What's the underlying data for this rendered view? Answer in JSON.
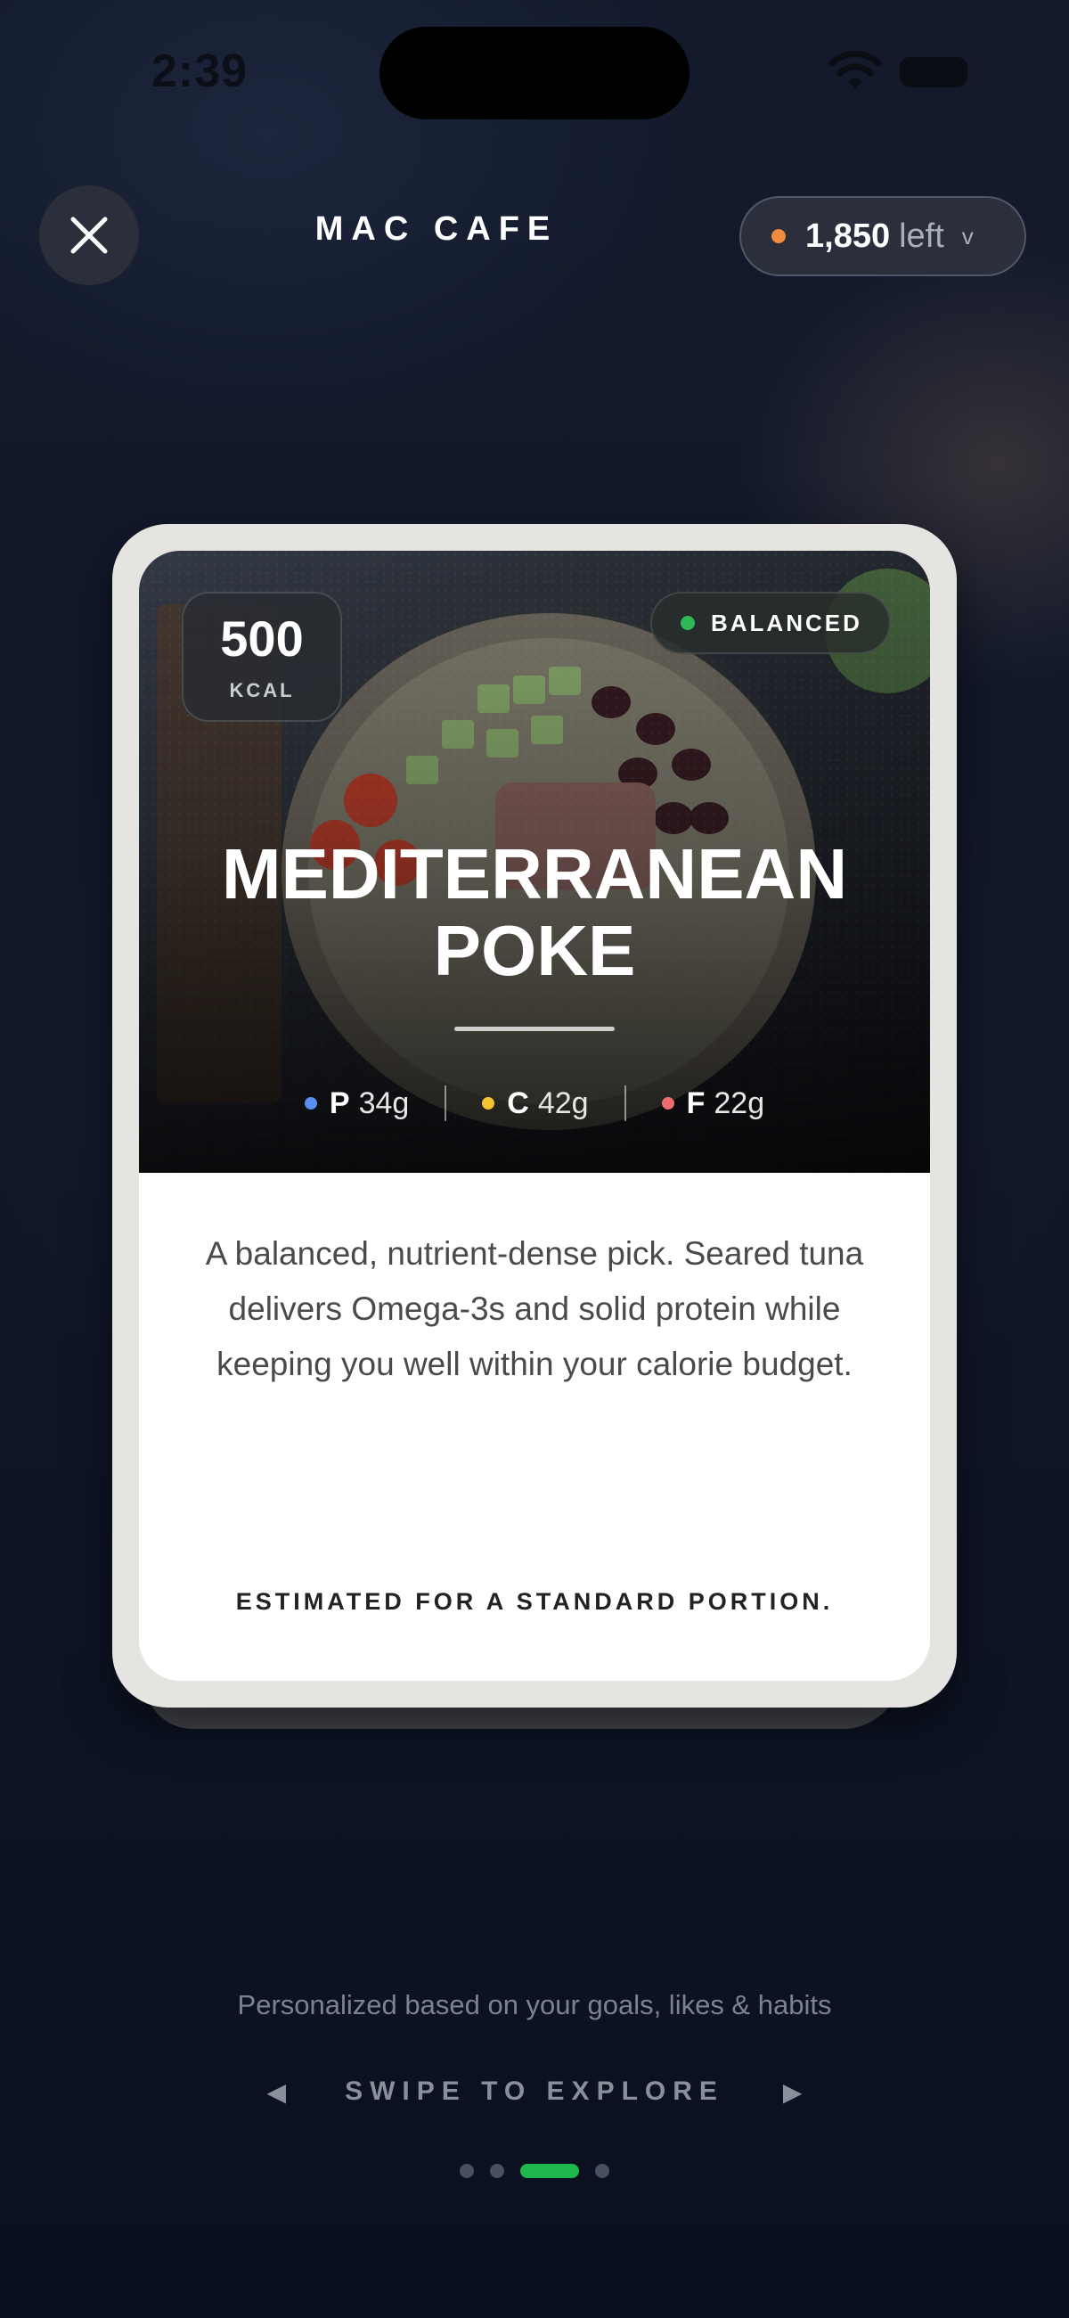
{
  "status_bar": {
    "time": "2:39"
  },
  "header": {
    "title": "MAC CAFE",
    "calories_left_value": "1,850",
    "calories_left_label": "left",
    "dropdown_glyph": "v"
  },
  "card": {
    "kcal_value": "500",
    "kcal_unit": "KCAL",
    "badge": "BALANCED",
    "dish_line1": "MEDITERRANEAN",
    "dish_line2": "POKE",
    "macros": [
      {
        "letter": "P",
        "value": "34g",
        "color": "#5b8def"
      },
      {
        "letter": "C",
        "value": "42g",
        "color": "#f2c531"
      },
      {
        "letter": "F",
        "value": "22g",
        "color": "#ee6b6b"
      }
    ],
    "description": "A balanced, nutrient-dense pick. Seared tuna delivers Omega-3s and solid protein while keeping you well within your calorie budget.",
    "footnote": "ESTIMATED FOR A STANDARD PORTION."
  },
  "footer": {
    "personalized_text": "Personalized based on your goals, likes & habits",
    "swipe_text": "SWIPE TO EXPLORE",
    "left_arrow": "◀",
    "right_arrow": "▶",
    "page_count": 4,
    "active_page_index": 2
  },
  "colors": {
    "accent_green": "#1fb84c",
    "calorie_dot": "#f08a3c",
    "balanced_dot": "#2fb85a"
  },
  "icons": [
    "close-icon",
    "wifi-icon",
    "battery-icon",
    "arrow-left-icon",
    "arrow-right-icon"
  ]
}
